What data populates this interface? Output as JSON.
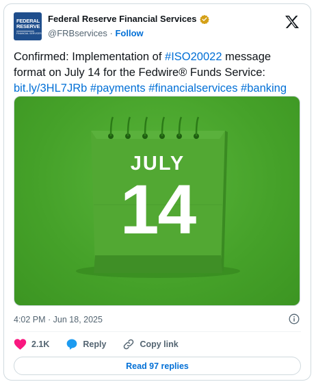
{
  "account": {
    "display_name": "Federal Reserve Financial Services",
    "handle": "@FRBservices",
    "separator": "·",
    "follow_label": "Follow",
    "avatar_logo_text": "FEDERAL RESERVE",
    "avatar_sub_text": "FINANCIAL SERVICES",
    "verified_color": "#d4a017",
    "avatar_color": "#1f4e8c"
  },
  "tweet": {
    "text_intro": "Confirmed: Implementation of ",
    "hashtag_iso": "#ISO20022",
    "text_rest": " message format on July 14 for the Fedwire® Funds Service:",
    "link": "bit.ly/3HL7JRb",
    "hashtags": [
      "#payments",
      "#financialservices",
      "#banking"
    ]
  },
  "media": {
    "month": "JULY",
    "day": "14",
    "background_color": "#45a129"
  },
  "meta": {
    "timestamp": "4:02 PM · Jun 18, 2025"
  },
  "actions": {
    "likes_count": "2.1K",
    "reply_label": "Reply",
    "copy_link_label": "Copy link",
    "read_replies_label": "Read 97 replies"
  },
  "colors": {
    "accent": "#006fd6",
    "like": "#f91880",
    "reply": "#1d9bf0"
  }
}
